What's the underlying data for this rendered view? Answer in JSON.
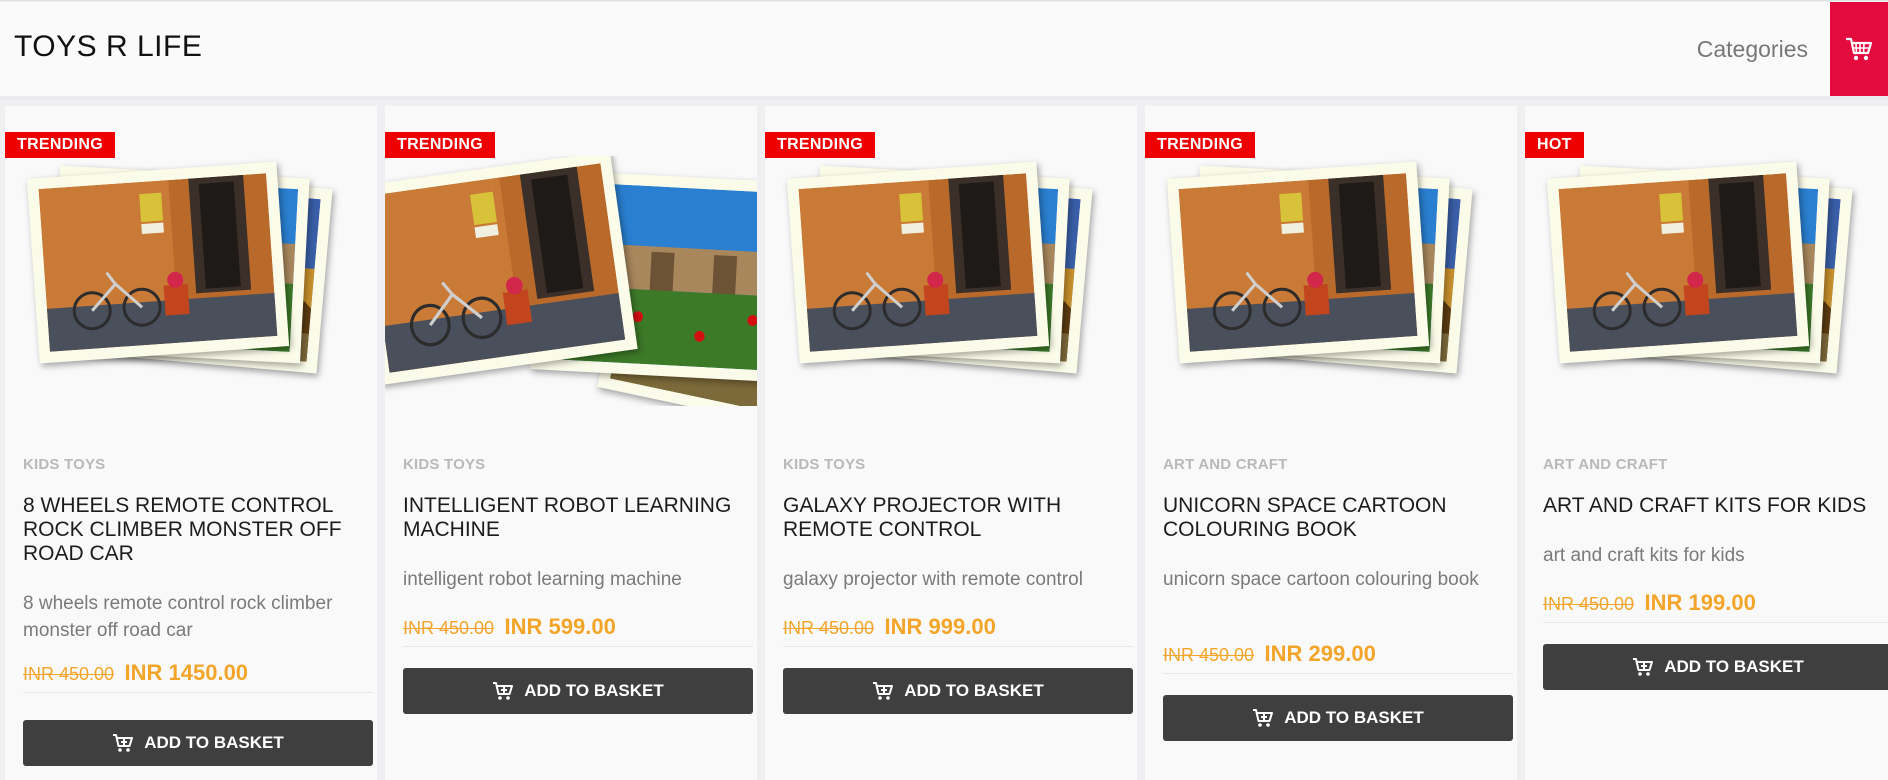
{
  "header": {
    "brand": "TOYS R LIFE",
    "nav_categories": "Categories",
    "cart_icon": "cart-icon"
  },
  "colors": {
    "accent_red": "#e30b3d",
    "badge_red": "#ee0000",
    "price_orange": "#f3a52a",
    "button_dark": "#3f3f3f"
  },
  "products": [
    {
      "badge": "TRENDING",
      "category": "KIDS TOYS",
      "title": "8 WHEELS REMOTE CONTROL ROCK CLIMBER MONSTER OFF ROAD CAR",
      "description": "8 wheels remote control rock climber monster off road car",
      "old_price": "INR 450.00",
      "price": "INR 1450.00",
      "button": "ADD TO BASKET"
    },
    {
      "badge": "TRENDING",
      "category": "KIDS TOYS",
      "title": "INTELLIGENT ROBOT LEARNING MACHINE",
      "description": "intelligent robot learning machine",
      "old_price": "INR 450.00",
      "price": "INR 599.00",
      "button": "ADD TO BASKET"
    },
    {
      "badge": "TRENDING",
      "category": "KIDS TOYS",
      "title": "GALAXY PROJECTOR WITH REMOTE CONTROL",
      "description": "galaxy projector with remote control",
      "old_price": "INR 450.00",
      "price": "INR 999.00",
      "button": "ADD TO BASKET"
    },
    {
      "badge": "TRENDING",
      "category": "ART AND CRAFT",
      "title": "UNICORN SPACE CARTOON COLOURING BOOK",
      "description": "unicorn space cartoon colouring book",
      "old_price": "INR 450.00",
      "price": "INR 299.00",
      "button": "ADD TO BASKET"
    },
    {
      "badge": "HOT",
      "category": "ART AND CRAFT",
      "title": "ART AND CRAFT KITS FOR KIDS",
      "description": "art and craft kits for kids",
      "old_price": "INR 450.00",
      "price": "INR 199.00",
      "button": "ADD TO BASKET"
    }
  ]
}
